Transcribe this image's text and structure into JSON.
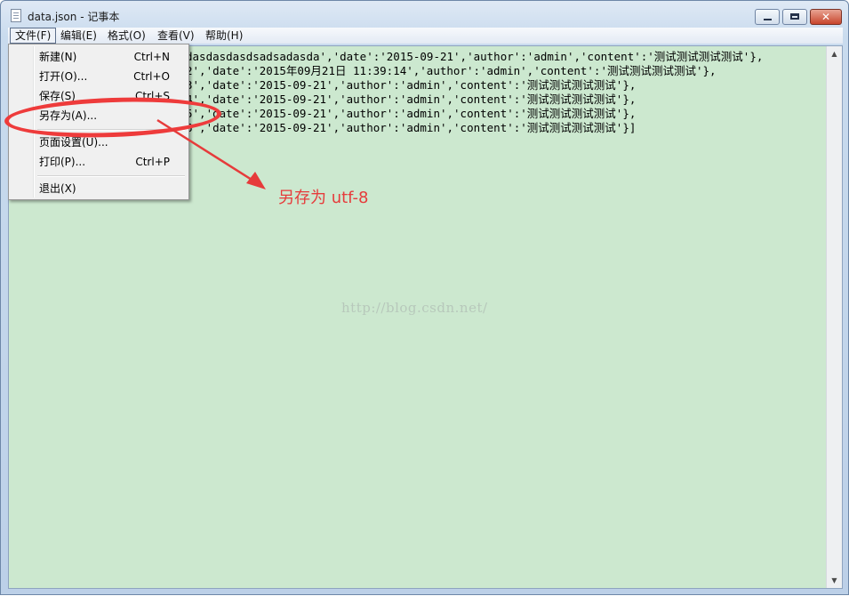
{
  "window": {
    "title": "data.json - 记事本",
    "close_label": "✕"
  },
  "menubar": {
    "items": [
      "文件(F)",
      "编辑(E)",
      "格式(O)",
      "查看(V)",
      "帮助(H)"
    ]
  },
  "file_menu": {
    "items": [
      {
        "label": "新建(N)",
        "shortcut": "Ctrl+N"
      },
      {
        "label": "打开(O)...",
        "shortcut": "Ctrl+O"
      },
      {
        "label": "保存(S)",
        "shortcut": "Ctrl+S"
      },
      {
        "label": "另存为(A)...",
        "shortcut": ""
      },
      {
        "label": "页面设置(U)...",
        "shortcut": ""
      },
      {
        "label": "打印(P)...",
        "shortcut": "Ctrl+P"
      },
      {
        "label": "退出(X)",
        "shortcut": ""
      }
    ]
  },
  "editor": {
    "lines": [
      "dasdasdasdsadsadasda','date':'2015-09-21','author':'admin','content':'测试测试测试测试'},",
      "2','date':'2015年09月21日 11:39:14','author':'admin','content':'测试测试测试测试'},",
      "3','date':'2015-09-21','author':'admin','content':'测试测试测试测试'},",
      "4','date':'2015-09-21','author':'admin','content':'测试测试测试测试'},",
      "5','date':'2015-09-21','author':'admin','content':'测试测试测试测试'},",
      "6','date':'2015-09-21','author':'admin','content':'测试测试测试测试'}]"
    ]
  },
  "watermark": "http://blog.csdn.net/",
  "annotation": {
    "text": "另存为 utf-8",
    "color": "#e63b3b"
  },
  "colors": {
    "editor_background": "#cce8cf",
    "annotation": "#e63b3b"
  }
}
